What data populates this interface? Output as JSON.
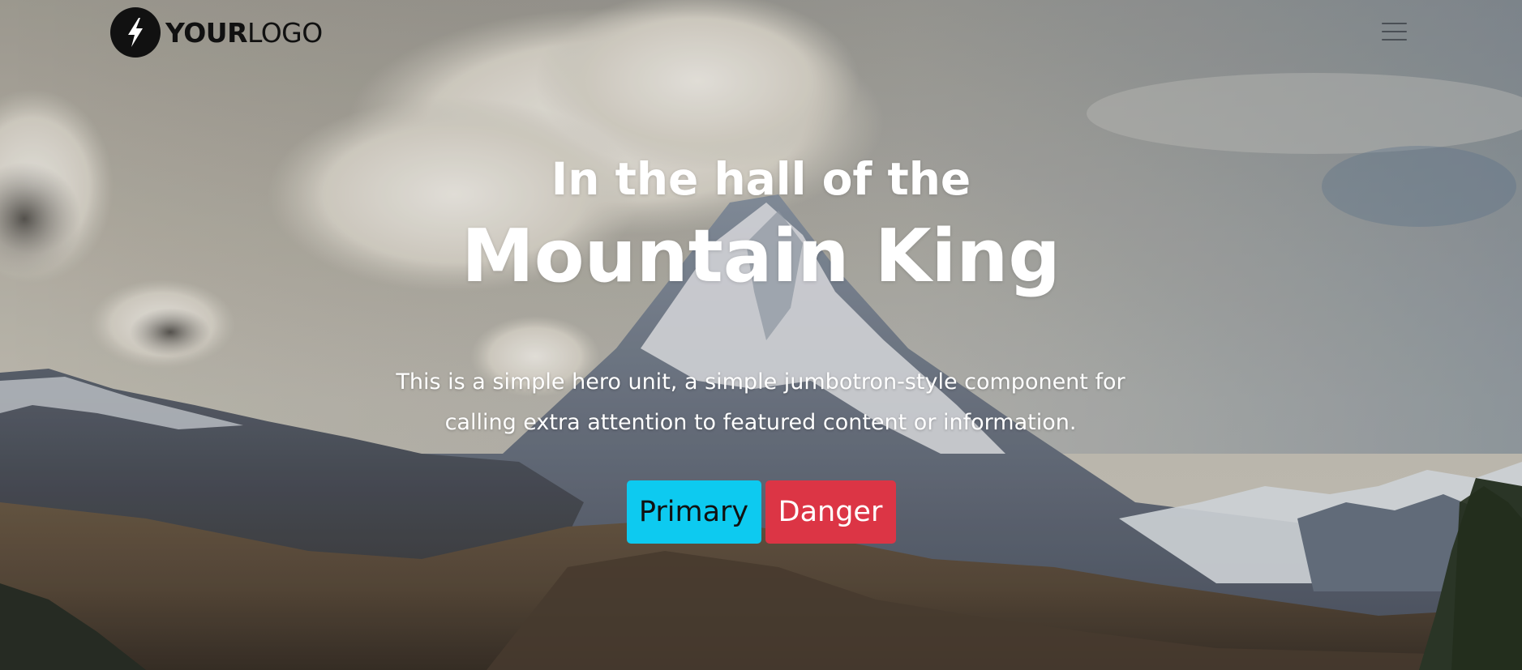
{
  "navbar": {
    "brand_strong": "YOUR",
    "brand_light": "LOGO",
    "brand_icon": "lightning-bolt-icon",
    "toggler_icon": "hamburger-menu-icon"
  },
  "hero": {
    "kicker": "In the hall of the",
    "headline": "Mountain King",
    "lead": "This is a simple hero unit, a simple jumbotron-style component for calling extra attention to featured content or information.",
    "primary_label": "Primary",
    "danger_label": "Danger"
  },
  "colors": {
    "primary": "#0dcaf0",
    "danger": "#dc3545",
    "text": "#ffffff",
    "logo": "#111111"
  }
}
